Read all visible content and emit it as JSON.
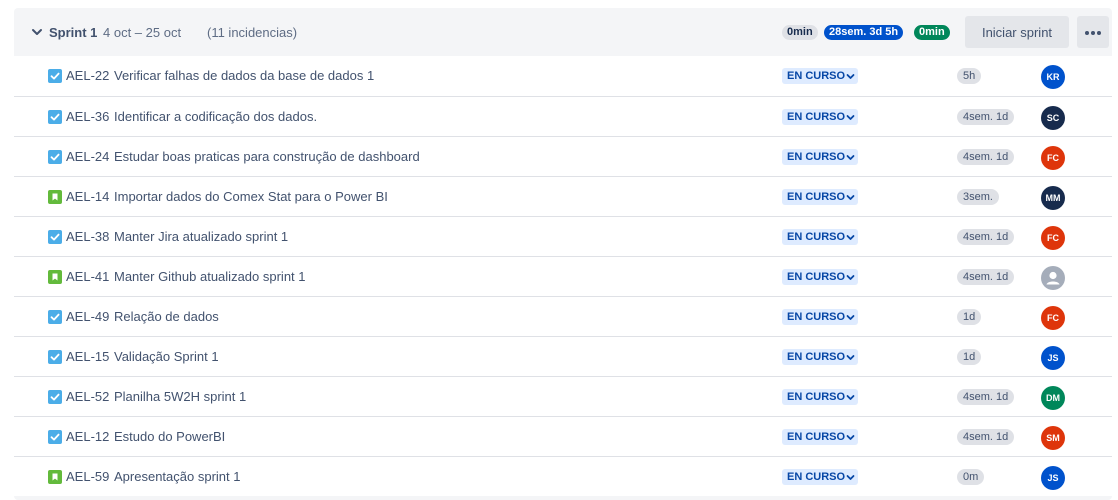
{
  "sprint": {
    "name": "Sprint 1",
    "dates": "4 oct – 25 oct",
    "issue_count": "(11 incidencias)",
    "stats": {
      "todo": "0min",
      "in_progress": "28sem. 3d 5h",
      "done": "0min"
    },
    "start_button": "Iniciar sprint",
    "more_icon": "more-horizontal-icon",
    "colors": {
      "todo_bg": "#dfe1e6",
      "in_progress_bg": "#0052cc",
      "done_bg": "#00875a",
      "status_bg": "#deebff",
      "status_text": "#0747a6"
    }
  },
  "issues": [
    {
      "type": "task",
      "key": "AEL-22",
      "summary": "Verificar falhas de dados da base de dados 1",
      "status": "EN CURSO",
      "estimate": "5h",
      "assignee": "KR",
      "avatar_color": "#0052cc"
    },
    {
      "type": "task",
      "key": "AEL-36",
      "summary": "Identificar a codificação dos dados.",
      "status": "EN CURSO",
      "estimate": "4sem. 1d",
      "assignee": "SC",
      "avatar_color": "#172b4d"
    },
    {
      "type": "task",
      "key": "AEL-24",
      "summary": "Estudar boas praticas para construção de dashboard",
      "status": "EN CURSO",
      "estimate": "4sem. 1d",
      "assignee": "FC",
      "avatar_color": "#de350b"
    },
    {
      "type": "story",
      "key": "AEL-14",
      "summary": "Importar dados do Comex Stat para o Power BI",
      "status": "EN CURSO",
      "estimate": "3sem.",
      "assignee": "MM",
      "avatar_color": "#172b4d"
    },
    {
      "type": "task",
      "key": "AEL-38",
      "summary": "Manter Jira atualizado sprint 1",
      "status": "EN CURSO",
      "estimate": "4sem. 1d",
      "assignee": "FC",
      "avatar_color": "#de350b"
    },
    {
      "type": "story",
      "key": "AEL-41",
      "summary": "Manter Github atualizado sprint 1",
      "status": "EN CURSO",
      "estimate": "4sem. 1d",
      "assignee": "",
      "avatar_color": "#a5adba"
    },
    {
      "type": "task",
      "key": "AEL-49",
      "summary": "Relação de dados",
      "status": "EN CURSO",
      "estimate": "1d",
      "assignee": "FC",
      "avatar_color": "#de350b"
    },
    {
      "type": "task",
      "key": "AEL-15",
      "summary": "Validação Sprint 1",
      "status": "EN CURSO",
      "estimate": "1d",
      "assignee": "JS",
      "avatar_color": "#0052cc"
    },
    {
      "type": "task",
      "key": "AEL-52",
      "summary": "Planilha 5W2H sprint 1",
      "status": "EN CURSO",
      "estimate": "4sem. 1d",
      "assignee": "DM",
      "avatar_color": "#00875a"
    },
    {
      "type": "task",
      "key": "AEL-12",
      "summary": "Estudo do PowerBI",
      "status": "EN CURSO",
      "estimate": "4sem. 1d",
      "assignee": "SM",
      "avatar_color": "#de350b"
    },
    {
      "type": "story",
      "key": "AEL-59",
      "summary": "Apresentação sprint 1",
      "status": "EN CURSO",
      "estimate": "0m",
      "assignee": "JS",
      "avatar_color": "#0052cc"
    }
  ]
}
